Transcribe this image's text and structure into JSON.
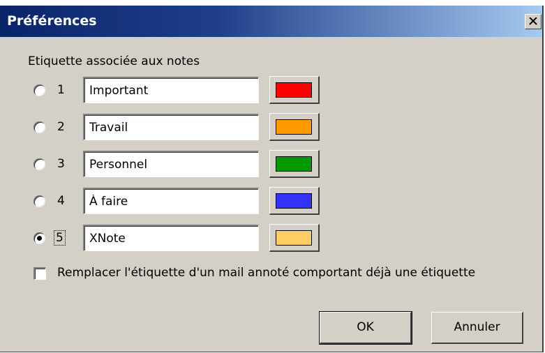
{
  "dialog": {
    "title": "Préférences",
    "close_label": "×"
  },
  "labels_group": {
    "heading": "Etiquette associée aux notes",
    "selected": 5,
    "items": [
      {
        "number": "1",
        "name": "Important",
        "color": "#ff0000"
      },
      {
        "number": "2",
        "name": "Travail",
        "color": "#ff9900"
      },
      {
        "number": "3",
        "name": "Personnel",
        "color": "#009900"
      },
      {
        "number": "4",
        "name": "À faire",
        "color": "#3333ff"
      },
      {
        "number": "5",
        "name": "XNote",
        "color": "#ffcc66"
      }
    ]
  },
  "replace_option": {
    "label": "Remplacer l'étiquette d'un mail annoté comportant déjà une étiquette",
    "checked": false
  },
  "buttons": {
    "ok": "OK",
    "cancel": "Annuler"
  }
}
